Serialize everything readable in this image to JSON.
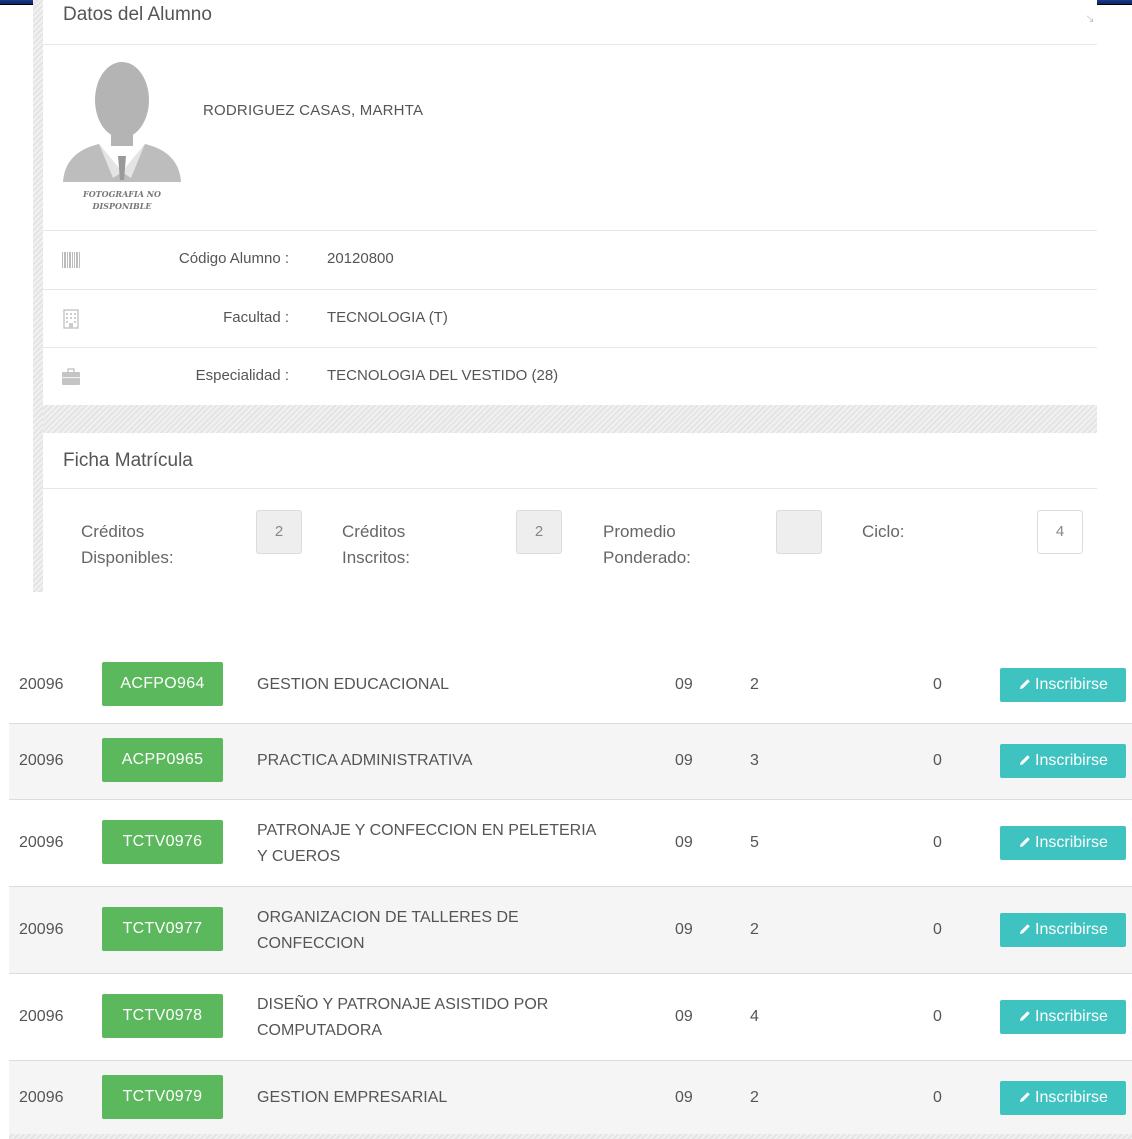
{
  "panel": {
    "title": "Datos del Alumno",
    "photo_caption_line1": "FOTOGRAFIA NO",
    "photo_caption_line2": "DISPONIBLE",
    "student_name": "RODRIGUEZ CASAS, MARHTA",
    "fields": [
      {
        "icon": "barcode-icon",
        "label": "Código Alumno :",
        "value": "20120800"
      },
      {
        "icon": "building-icon",
        "label": "Facultad :",
        "value": "TECNOLOGIA (T)"
      },
      {
        "icon": "briefcase-icon",
        "label": "Especialidad :",
        "value": "TECNOLOGIA DEL VESTIDO (28)"
      }
    ]
  },
  "ficha": {
    "title": "Ficha Matrícula",
    "stats": [
      {
        "label_line1": "Créditos",
        "label_line2": "Disponibles:",
        "value": "2"
      },
      {
        "label_line1": "Créditos",
        "label_line2": "Inscritos:",
        "value": "2"
      },
      {
        "label_line1": "Promedio",
        "label_line2": "Ponderado:",
        "value": ""
      },
      {
        "label_line1": "Ciclo:",
        "label_line2": "",
        "value": "4"
      }
    ]
  },
  "courses": [
    {
      "period": "20096",
      "code": "ACFPO964",
      "name_line1": "GESTION EDUCACIONAL",
      "name_line2": "",
      "section": "09",
      "credits": "2",
      "enrolled": "0",
      "action": "Inscribirse"
    },
    {
      "period": "20096",
      "code": "ACPP0965",
      "name_line1": "PRACTICA ADMINISTRATIVA",
      "name_line2": "",
      "section": "09",
      "credits": "3",
      "enrolled": "0",
      "action": "Inscribirse"
    },
    {
      "period": "20096",
      "code": "TCTV0976",
      "name_line1": "PATRONAJE Y CONFECCION EN PELETERIA",
      "name_line2": "Y CUEROS",
      "section": "09",
      "credits": "5",
      "enrolled": "0",
      "action": "Inscribirse"
    },
    {
      "period": "20096",
      "code": "TCTV0977",
      "name_line1": "ORGANIZACION DE TALLERES DE",
      "name_line2": "CONFECCION",
      "section": "09",
      "credits": "2",
      "enrolled": "0",
      "action": "Inscribirse"
    },
    {
      "period": "20096",
      "code": "TCTV0978",
      "name_line1": "DISEÑO Y PATRONAJE ASISTIDO POR",
      "name_line2": "COMPUTADORA",
      "section": "09",
      "credits": "4",
      "enrolled": "0",
      "action": "Inscribirse"
    },
    {
      "period": "20096",
      "code": "TCTV0979",
      "name_line1": "GESTION EMPRESARIAL",
      "name_line2": "",
      "section": "09",
      "credits": "2",
      "enrolled": "0",
      "action": "Inscribirse"
    }
  ],
  "colors": {
    "code_badge": "#5cb85c",
    "enroll_button": "#3fc3c0",
    "top_bar": "#1b3c8c"
  }
}
